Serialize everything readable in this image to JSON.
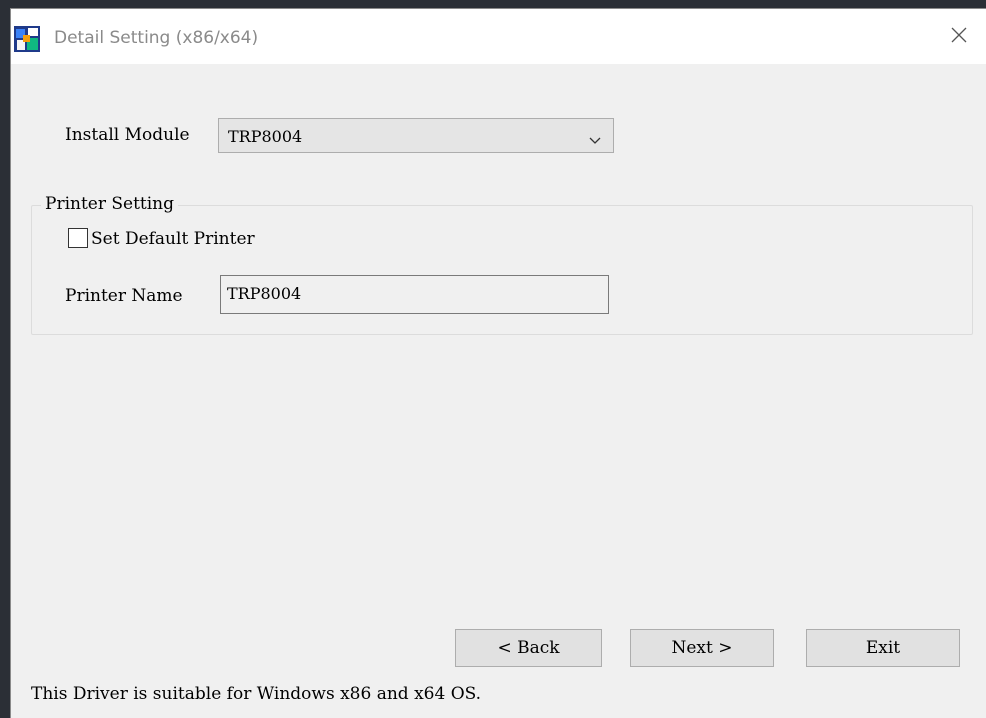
{
  "window": {
    "title": "Detail Setting (x86/x64)",
    "icon": "app-icon",
    "close_icon": "close-icon"
  },
  "install_module": {
    "label": "Install Module",
    "selected": "TRP8004"
  },
  "printer_setting": {
    "legend": "Printer Setting",
    "set_default_label": "Set Default Printer",
    "set_default_checked": false,
    "printer_name_label": "Printer Name",
    "printer_name_value": "TRP8004"
  },
  "buttons": {
    "back": "< Back",
    "next": "Next >",
    "exit": "Exit"
  },
  "footer": {
    "note": "This Driver is suitable for Windows x86 and x64 OS."
  }
}
